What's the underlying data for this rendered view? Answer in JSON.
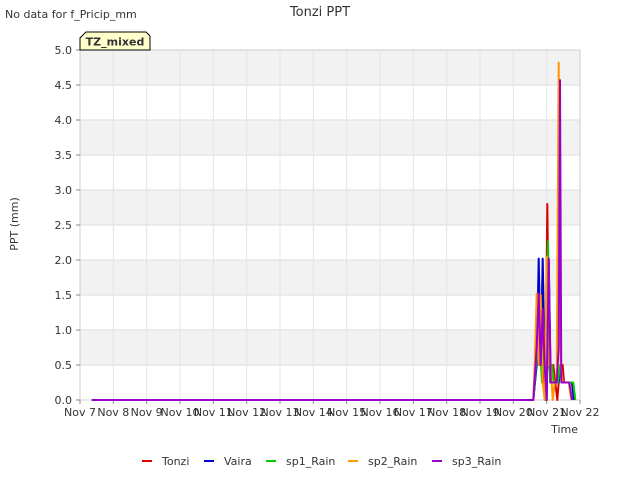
{
  "header": {
    "note": "No data for f_Pricip_mm"
  },
  "badge": {
    "text": "TZ_mixed"
  },
  "chart_data": {
    "type": "line",
    "title": "Tonzi PPT",
    "xlabel": "Time",
    "ylabel": "PPT (mm)",
    "xlim": [
      0,
      15
    ],
    "ylim": [
      0,
      5
    ],
    "y_ticks": [
      0,
      0.5,
      1,
      1.5,
      2,
      2.5,
      3,
      3.5,
      4,
      4.5,
      5
    ],
    "y_tick_labels": [
      "0.0",
      "0.5",
      "1.0",
      "1.5",
      "2.0",
      "2.5",
      "3.0",
      "3.5",
      "4.0",
      "4.5",
      "5.0"
    ],
    "x_ticks": [
      0,
      1,
      2,
      3,
      4,
      5,
      6,
      7,
      8,
      9,
      10,
      11,
      12,
      13,
      14,
      15
    ],
    "x_tick_labels": [
      "Nov 7",
      "Nov 8",
      "Nov 9",
      "Nov 10",
      "Nov 11",
      "Nov 12",
      "Nov 13",
      "Nov 14",
      "Nov 15",
      "Nov 16",
      "Nov 17",
      "Nov 18",
      "Nov 19",
      "Nov 20",
      "Nov 21",
      "Nov 22"
    ],
    "grid": "horizontal bands",
    "legend_position": "bottom",
    "series": [
      {
        "name": "Tonzi",
        "color": "#dd0000",
        "x": [
          0.35,
          13.6,
          13.68,
          13.74,
          13.8,
          13.86,
          13.9,
          13.96,
          14.02,
          14.08,
          14.14,
          14.2,
          14.26,
          14.32,
          14.36,
          14.42,
          14.48,
          14.52,
          14.58,
          14.64,
          14.7,
          14.76,
          14.82
        ],
        "y": [
          0,
          0,
          0.5,
          1.5,
          0.5,
          1.5,
          0.5,
          0,
          2.8,
          0.5,
          0.25,
          0.5,
          0.25,
          0,
          0.25,
          0.5,
          0.5,
          0.25,
          0.25,
          0.25,
          0.25,
          0.25,
          0
        ]
      },
      {
        "name": "Vaira",
        "color": "#0000cc",
        "x": [
          0.35,
          13.6,
          13.7,
          13.76,
          13.82,
          13.88,
          13.94,
          14.0,
          14.06,
          14.12,
          14.18,
          14.24,
          14.3,
          14.36,
          14.42,
          14.48,
          14.56,
          14.64,
          14.7,
          14.76,
          14.82
        ],
        "y": [
          0,
          0,
          0.5,
          2.02,
          0.5,
          2.02,
          0.5,
          0,
          2.02,
          0.25,
          0.25,
          0.25,
          0.25,
          0.25,
          0.5,
          0.25,
          0.25,
          0.25,
          0.25,
          0.25,
          0
        ]
      },
      {
        "name": "sp1_Rain",
        "color": "#00cc00",
        "x": [
          0.35,
          13.6,
          13.72,
          13.8,
          13.86,
          13.92,
          13.98,
          14.04,
          14.1,
          14.16,
          14.22,
          14.28,
          14.34,
          14.4,
          14.46,
          14.52,
          14.6,
          14.66,
          14.74,
          14.8,
          14.86
        ],
        "y": [
          0,
          0,
          0.75,
          0.75,
          0.25,
          0.75,
          0,
          2.27,
          0.25,
          0.5,
          0.25,
          0.25,
          0.25,
          0.5,
          0.25,
          0.25,
          0.25,
          0.25,
          0.25,
          0.25,
          0
        ]
      },
      {
        "name": "sp2_Rain",
        "color": "#ff9900",
        "x": [
          0.35,
          13.6,
          13.64,
          13.7,
          13.76,
          13.82,
          13.88,
          13.94,
          14.0,
          14.06,
          14.12,
          14.18,
          14.24,
          14.3,
          14.36,
          14.42,
          14.48,
          14.54,
          14.6,
          14.66,
          14.74
        ],
        "y": [
          0,
          0,
          0.5,
          1.52,
          0.5,
          1.5,
          0.25,
          0,
          2.05,
          0.5,
          0.5,
          0,
          0.25,
          0.25,
          4.82,
          0.5,
          0.25,
          0.25,
          0.25,
          0.25,
          0
        ]
      },
      {
        "name": "sp3_Rain",
        "color": "#9900cc",
        "x": [
          0.35,
          13.6,
          13.7,
          13.76,
          13.82,
          13.88,
          13.94,
          14.0,
          14.06,
          14.12,
          14.18,
          14.24,
          14.3,
          14.36,
          14.4,
          14.44,
          14.5,
          14.56,
          14.62,
          14.68,
          14.76
        ],
        "y": [
          0,
          0,
          0.75,
          1.52,
          0.5,
          1.3,
          0.5,
          0,
          2.02,
          0.25,
          0.25,
          0.25,
          0.25,
          0.75,
          4.57,
          0.25,
          0.25,
          0.25,
          0.25,
          0.25,
          0
        ]
      }
    ]
  }
}
